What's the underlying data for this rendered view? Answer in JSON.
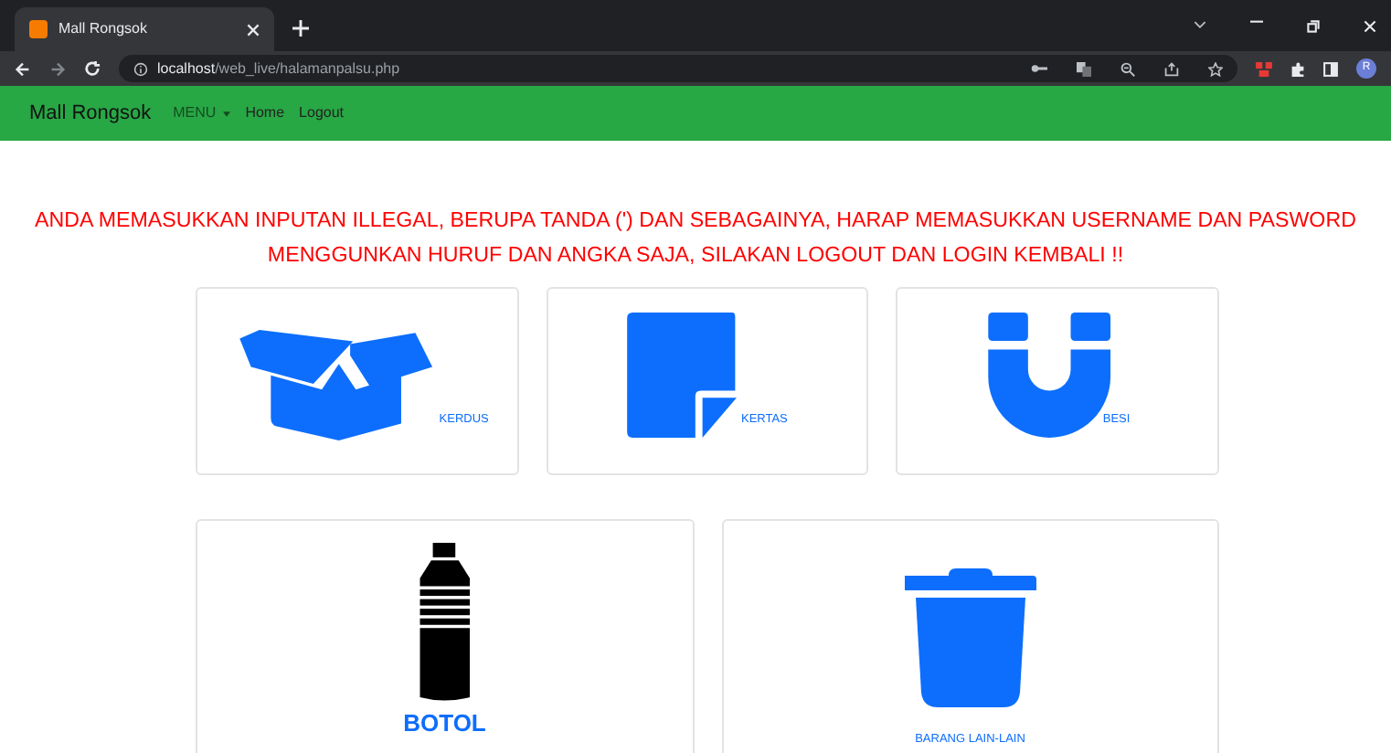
{
  "browser": {
    "tab_title": "Mall Rongsok",
    "url_host": "localhost",
    "url_path": "/web_live/halamanpalsu.php",
    "profile_initial": "R"
  },
  "navbar": {
    "brand": "Mall Rongsok",
    "items": [
      {
        "label": "MENU",
        "kind": "dropdown"
      },
      {
        "label": "Home",
        "kind": "link"
      },
      {
        "label": "Logout",
        "kind": "link"
      }
    ]
  },
  "warning": "ANDA MEMASUKKAN INPUTAN ILLEGAL, BERUPA TANDA (') DAN SEBAGAINYA, HARAP MEMASUKKAN USERNAME DAN PASWORD MENGGUNKAN HURUF DAN ANGKA SAJA, SILAKAN LOGOUT DAN LOGIN KEMBALI !!",
  "rows": [
    [
      {
        "label": "KERDUS",
        "kind": "box",
        "large_label": false
      },
      {
        "label": "KERTAS",
        "kind": "paper",
        "large_label": false
      },
      {
        "label": "BESI",
        "kind": "magnet",
        "large_label": false
      }
    ],
    [
      {
        "label": "BOTOL",
        "kind": "bottle",
        "large_label": true
      },
      {
        "label": "BARANG LAIN-LAIN",
        "kind": "trash",
        "large_label": false
      }
    ]
  ]
}
